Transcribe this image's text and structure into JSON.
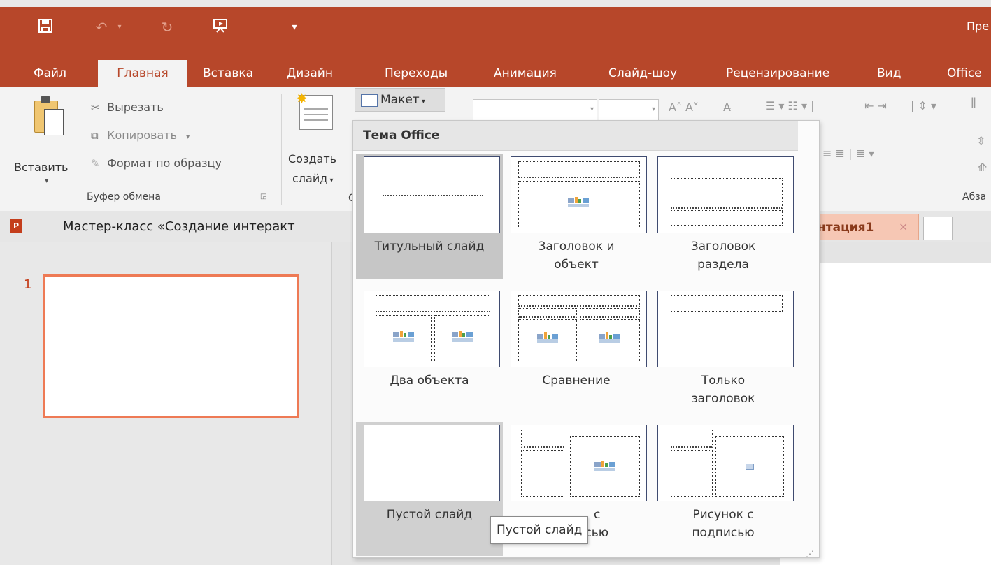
{
  "app": {
    "title": "Пре",
    "accent": "#b7472a"
  },
  "qat": {
    "icons": [
      "save-icon",
      "undo-icon",
      "redo-icon",
      "present-icon",
      "customize-icon"
    ]
  },
  "tabs": [
    {
      "label": "Файл"
    },
    {
      "label": "Главная"
    },
    {
      "label": "Вставка"
    },
    {
      "label": "Дизайн"
    },
    {
      "label": "Переходы"
    },
    {
      "label": "Анимация"
    },
    {
      "label": "Слайд-шоу"
    },
    {
      "label": "Рецензирование"
    },
    {
      "label": "Вид"
    },
    {
      "label": "Office"
    }
  ],
  "ribbon": {
    "paste": "Вставить",
    "paste_arrow": "▾",
    "cut": "Вырезать",
    "copy": "Копировать",
    "copy_arrow": "▾",
    "format_painter": "Формат по образцу",
    "clipboard_group": "Буфер обмена",
    "new_slide_line1": "Создать",
    "new_slide_line2": "слайд",
    "layout": "Макет",
    "paragraph_group": "Абза"
  },
  "doc": {
    "title": "Мастер-класс «Создание интеракт",
    "tab2": "нтация1",
    "tab2_close": "×"
  },
  "thumbs": {
    "slide_number": "1"
  },
  "gallery": {
    "header": "Тема Office",
    "layouts": [
      {
        "line1": "Титульный слайд",
        "line2": ""
      },
      {
        "line1": "Заголовок и",
        "line2": "объект"
      },
      {
        "line1": "Заголовок",
        "line2": "раздела"
      },
      {
        "line1": "Два объекта",
        "line2": ""
      },
      {
        "line1": "Сравнение",
        "line2": ""
      },
      {
        "line1": "Только",
        "line2": "заголовок"
      },
      {
        "line1": "Пустой слайд",
        "line2": ""
      },
      {
        "line1": "с",
        "line2": "подписью"
      },
      {
        "line1": "Рисунок с",
        "line2": "подписью"
      }
    ],
    "tooltip": "Пустой слайд"
  }
}
